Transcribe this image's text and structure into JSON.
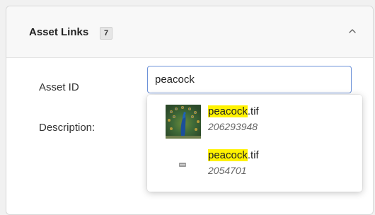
{
  "panel": {
    "title": "Asset Links",
    "count": "7",
    "collapse_icon": "chevron-up-icon"
  },
  "form": {
    "asset_id_label": "Asset ID",
    "asset_id_value": "peacock",
    "description_label": "Description:"
  },
  "results": [
    {
      "match": "peacock",
      "rest": ".tif",
      "id": "206293948",
      "icon": "peacock-thumbnail"
    },
    {
      "match": "peacock",
      "rest": ".tif",
      "id": "2054701",
      "icon": "image-placeholder-icon"
    }
  ],
  "colors": {
    "highlight": "#fff200",
    "input_border": "#6d92d8"
  }
}
